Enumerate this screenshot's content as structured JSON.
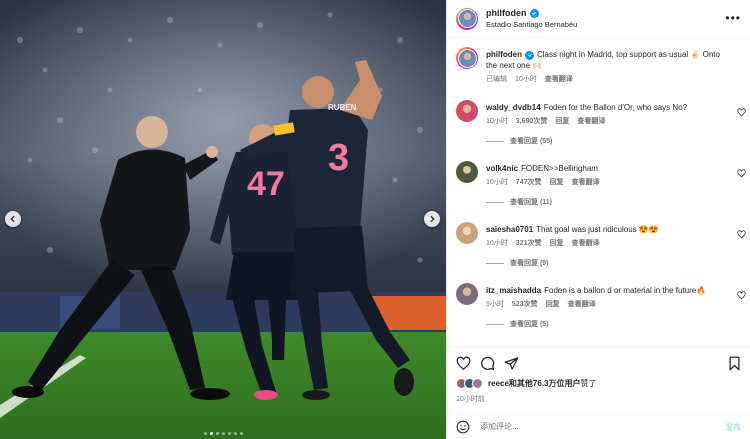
{
  "post": {
    "username": "philfoden",
    "location": "Estadio Santiago Bernabéu",
    "caption_text": "Class night in Madrid, top support as usual ✌🏻 Onto the next one 🙌🏻",
    "caption_edited": "已编辑",
    "caption_time": "10小时",
    "caption_translate": "查看翻译",
    "more_icon": "more-horizontal-icon",
    "verified_color": "#0095f6"
  },
  "carousel": {
    "prev_icon": "chevron-left-icon",
    "next_icon": "chevron-right-icon",
    "dot_count": 7,
    "active_dot": 1,
    "shirt_numbers": [
      "47",
      "3"
    ],
    "shirt_name": "RUBEN"
  },
  "comments": [
    {
      "username": "waldy_dvdb14",
      "text": "Foden for the Ballon d'Or, who says No?",
      "time": "10小时",
      "likes": "3,690次赞",
      "reply": "回复",
      "translate": "查看翻译",
      "view_replies": "查看回复 (55)",
      "avatar_color": "#d14a6a"
    },
    {
      "username": "volk4nic",
      "text": "FODEN>>Bellingham",
      "time": "10小时",
      "likes": "747次赞",
      "reply": "回复",
      "translate": "查看翻译",
      "view_replies": "查看回复 (11)",
      "avatar_color": "#4f5a3c"
    },
    {
      "username": "saiesha0701",
      "text": "That goal was just ridiculous 😍😍",
      "time": "10小时",
      "likes": "321次赞",
      "reply": "回复",
      "translate": "查看翻译",
      "view_replies": "查看回复 (9)",
      "avatar_color": "#caa27a"
    },
    {
      "username": "itz_maishadda",
      "text": "Foden is a ballon d or material in the future🔥",
      "time": "9小时",
      "likes": "523次赞",
      "reply": "回复",
      "translate": "查看翻译",
      "view_replies": "查看回复 (5)",
      "avatar_color": "#7d6a7a"
    }
  ],
  "actions": {
    "like_icon": "heart-icon",
    "comment_icon": "comment-icon",
    "share_icon": "send-icon",
    "save_icon": "bookmark-icon"
  },
  "likes_summary": {
    "user": "reece",
    "rest": "和其他76.3万位用户",
    "suffix": "赞了"
  },
  "post_time": "10小时前",
  "composer": {
    "emoji_icon": "smiley-icon",
    "placeholder": "添加评论...",
    "post_label": "发布"
  }
}
